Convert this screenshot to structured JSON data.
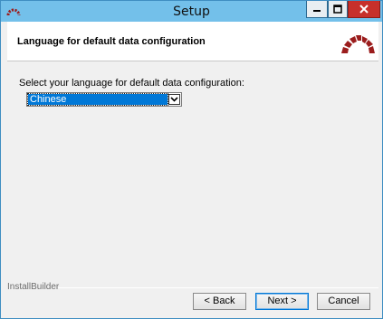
{
  "window": {
    "title": "Setup",
    "controls": {
      "minimize": "minimize-icon",
      "maximize": "maximize-icon",
      "close": "close-icon"
    }
  },
  "header": {
    "title": "Language for default data configuration",
    "logo": "redmine-logo-icon"
  },
  "main": {
    "prompt": "Select your language for default data configuration:",
    "language_select": {
      "selected": "Chinese"
    }
  },
  "footer": {
    "brand": "InstallBuilder",
    "back_label": "< Back",
    "next_label": "Next >",
    "cancel_label": "Cancel"
  },
  "colors": {
    "titlebar": "#73c0ea",
    "close_button": "#c7302b",
    "selection": "#0078d7",
    "logo": "#9b1d1d"
  }
}
